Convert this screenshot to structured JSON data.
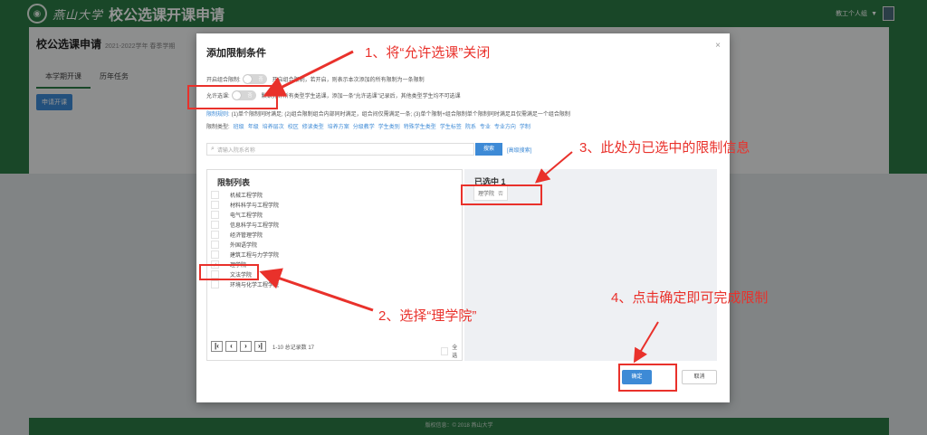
{
  "header": {
    "university_name": "燕山大学",
    "app_title": "校公选课开课申请",
    "user_role": "教工个人组"
  },
  "page": {
    "title": "校公选课申请",
    "subtitle": "2021-2022学年 春季学期",
    "tabs": [
      "本学期开课",
      "历年任务"
    ],
    "apply_button": "申请开课"
  },
  "footer": {
    "copyright": "版权信息：© 2018 燕山大学"
  },
  "modal": {
    "title": "添加限制条件",
    "combo_label": "开启组合限制:",
    "combo_desc": "开启组合限制，若开启，则表示本次添加的所有限制为一条限制",
    "allow_label": "允许选课:",
    "allow_desc": "默认允许所有类型学生选课，添加一条“允许选课”记录后，其他类型学生均不可选课",
    "switch_off_text": "否",
    "rule_label": "限制规则:",
    "rule_desc": "(1)单个限制同时满足; (2)组合限制组合内部同时满足，组合间仅需满足一条; (3)单个限制+组合限制单个限制同时满足且仅需满足一个组合限制",
    "type_label": "限制类型:",
    "types": [
      "班级",
      "年级",
      "培养层次",
      "校区",
      "修读类型",
      "培养方案",
      "分级教学",
      "学生类别",
      "特殊学生类型",
      "学生标签",
      "院系",
      "专业",
      "专业方向",
      "学制"
    ],
    "search_placeholder": "请输入院系名称",
    "search_button": "搜索",
    "advanced_search": "[高级搜索]",
    "list_title": "限制列表",
    "departments": [
      {
        "name": "机械工程学院",
        "checked": false
      },
      {
        "name": "材料科学与工程学院",
        "checked": false
      },
      {
        "name": "电气工程学院",
        "checked": false
      },
      {
        "name": "信息科学与工程学院",
        "checked": false
      },
      {
        "name": "经济管理学院",
        "checked": false
      },
      {
        "name": "外国语学院",
        "checked": false
      },
      {
        "name": "建筑工程与力学学院",
        "checked": false
      },
      {
        "name": "理学院",
        "checked": true
      },
      {
        "name": "文法学院",
        "checked": false
      },
      {
        "name": "环境与化学工程学院",
        "checked": false
      }
    ],
    "pager_text": "1-10 总记录数 17",
    "select_all": "全选",
    "selected_title": "已选中 1",
    "selected_item": "理学院",
    "selected_item_flag": "否",
    "ok_button": "确定",
    "cancel_button": "取消"
  },
  "annotations": {
    "step1": "1、将“允许选课”关闭",
    "step2": "2、选择“理学院”",
    "step3": "3、此处为已选中的限制信息",
    "step4": "4、点击确定即可完成限制"
  },
  "colors": {
    "header_green": "#2c7a45",
    "primary_blue": "#3d8ad6",
    "annotation_red": "#e9312b"
  }
}
